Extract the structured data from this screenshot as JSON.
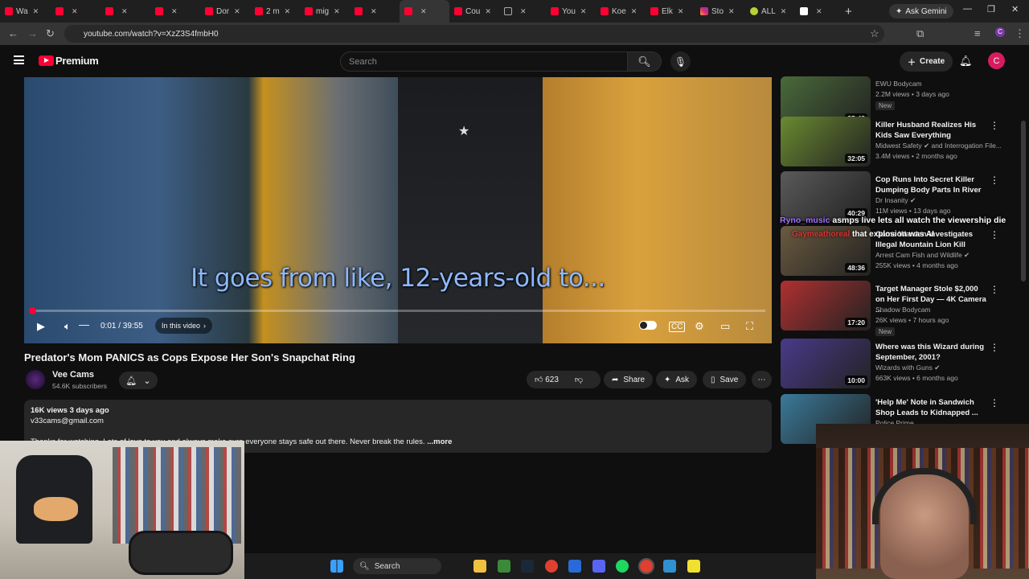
{
  "browser": {
    "tabs": [
      {
        "label": "Wa",
        "icon": "youtube-icon"
      },
      {
        "label": "",
        "icon": "youtube-icon"
      },
      {
        "label": "",
        "icon": "youtube-icon"
      },
      {
        "label": "",
        "icon": "youtube-icon"
      },
      {
        "label": "Dor",
        "icon": "youtube-icon"
      },
      {
        "label": "2 m",
        "icon": "youtube-icon"
      },
      {
        "label": "mig",
        "icon": "youtube-icon"
      },
      {
        "label": "",
        "icon": "youtube-icon"
      },
      {
        "label": "",
        "icon": "youtube-icon",
        "active": true
      },
      {
        "label": "Cou",
        "icon": "youtube-icon"
      },
      {
        "label": "",
        "icon": "x-icon"
      },
      {
        "label": "You",
        "icon": "youtube-icon"
      },
      {
        "label": "Koe",
        "icon": "youtube-icon"
      },
      {
        "label": "Elk",
        "icon": "youtube-icon"
      },
      {
        "label": "Sto",
        "icon": "instagram-icon"
      },
      {
        "label": "ALL",
        "icon": "globe-icon"
      },
      {
        "label": "",
        "icon": "wikipedia-icon"
      }
    ],
    "ask_gemini": "Ask Gemini",
    "url": "youtube.com/watch?v=XzZ3S4fmbH0"
  },
  "youtube": {
    "logo_text": "Premium",
    "search_placeholder": "Search",
    "create_label": "Create",
    "avatar_letter": "C"
  },
  "player": {
    "caption": "It goes from like, 12-years-old to...",
    "time": "0:01 / 39:55",
    "in_this_video": "In this video",
    "progress": 0.0004
  },
  "video": {
    "title": "Predator's Mom PANICS as Cops Expose Her Son's Snapchat Ring",
    "channel": "Vee Cams",
    "subscribers": "54.6K subscribers",
    "likes": "623",
    "share": "Share",
    "ask": "Ask",
    "save": "Save"
  },
  "description": {
    "stats": "16K views  3 days ago",
    "email": "v33cams@gmail.com",
    "text": "Thanks for watching. Lots of love to you and always make sure everyone stays safe out there. Never break the rules.",
    "more": " ...more"
  },
  "recommendations": [
    {
      "title": "",
      "channel": "EWU Bodycam",
      "meta": "2.2M views • 3 days ago",
      "duration": "25:43",
      "badge": "New",
      "thumb": "#4a6a3a"
    },
    {
      "title": "Killer Husband Realizes His Kids Saw Everything",
      "channel": "Midwest Safety ✔ and Interrogation File...",
      "meta": "3.4M views • 2 months ago",
      "duration": "32:05",
      "badge": "",
      "thumb": "#6a8a30"
    },
    {
      "title": "Cop Runs Into Secret Killer Dumping Body Parts In River",
      "channel": "Dr Insanity ✔",
      "meta": "11M views • 13 days ago",
      "duration": "40:29",
      "badge": "",
      "thumb": "#5a5a5a"
    },
    {
      "title": "Game Warden Investigates Illegal Mountain Lion Kill",
      "channel": "Arrest Cam Fish and Wildlife ✔",
      "meta": "255K views • 4 months ago",
      "duration": "48:36",
      "badge": "",
      "thumb": "#6a5a40"
    },
    {
      "title": "Target Manager Stole $2,000 on Her First Day — 4K Camera ...",
      "channel": "Shadow Bodycam",
      "meta": "26K views • 7 hours ago",
      "duration": "17:20",
      "badge": "New",
      "thumb": "#b03030"
    },
    {
      "title": "Where was this Wizard during September, 2001?",
      "channel": "Wizards with Guns ✔",
      "meta": "663K views • 6 months ago",
      "duration": "10:00",
      "badge": "",
      "thumb": "#4a3a8a"
    },
    {
      "title": "'Help Me' Note in Sandwich Shop Leads to Kidnapped ...",
      "channel": "Police Prime",
      "meta": "",
      "duration": "",
      "badge": "",
      "thumb": "#3a7a9a"
    }
  ],
  "stream_overlay": {
    "chat_user": "Ryno_music",
    "chat_text": " asmps live lets all watch the viewership die",
    "chat_user2": "Gaymeathoreal",
    "chat_text2": " that explosion was AI"
  },
  "taskbar": {
    "search_label": "Search"
  }
}
